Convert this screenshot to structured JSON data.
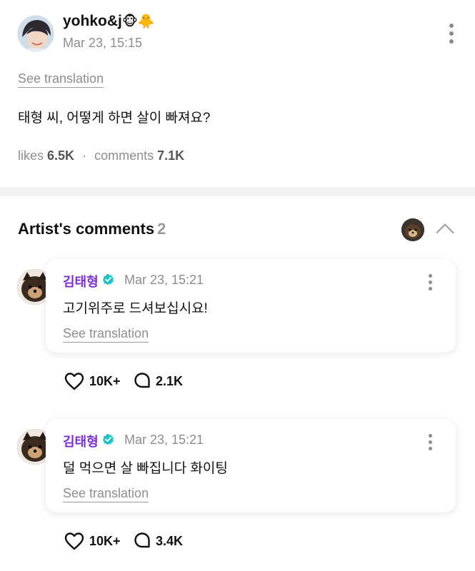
{
  "post": {
    "username": "yohko&j",
    "username_emoji": "🐵🐥",
    "timestamp": "Mar 23, 15:15",
    "see_translation": "See translation",
    "body": "태형 씨, 어떻게 하면 살이 빠져요?",
    "stats": {
      "likes_label": "likes",
      "likes_value": "6.5K",
      "separator": "·",
      "comments_label": "comments",
      "comments_value": "7.1K"
    }
  },
  "artist_comments": {
    "title": "Artist's comments",
    "count": "2",
    "items": [
      {
        "author": "김태형",
        "timestamp": "Mar 23, 15:21",
        "text": "고기위주로 드셔보십시요!",
        "see_translation": "See translation",
        "likes": "10K+",
        "replies": "2.1K"
      },
      {
        "author": "김태형",
        "timestamp": "Mar 23, 15:21",
        "text": "덜 먹으면 살 빠집니다 화이팅",
        "see_translation": "See translation",
        "likes": "10K+",
        "replies": "3.4K"
      }
    ]
  },
  "icons": {
    "more": "kebab-menu-icon",
    "collapse": "chevron-up-icon",
    "verified": "verified-badge-icon",
    "like": "heart-icon",
    "reply": "speech-bubble-icon"
  },
  "colors": {
    "artist_name": "#7b2fd0",
    "verified_badge": "#19c3c9",
    "muted_text": "#8e8e8e"
  }
}
